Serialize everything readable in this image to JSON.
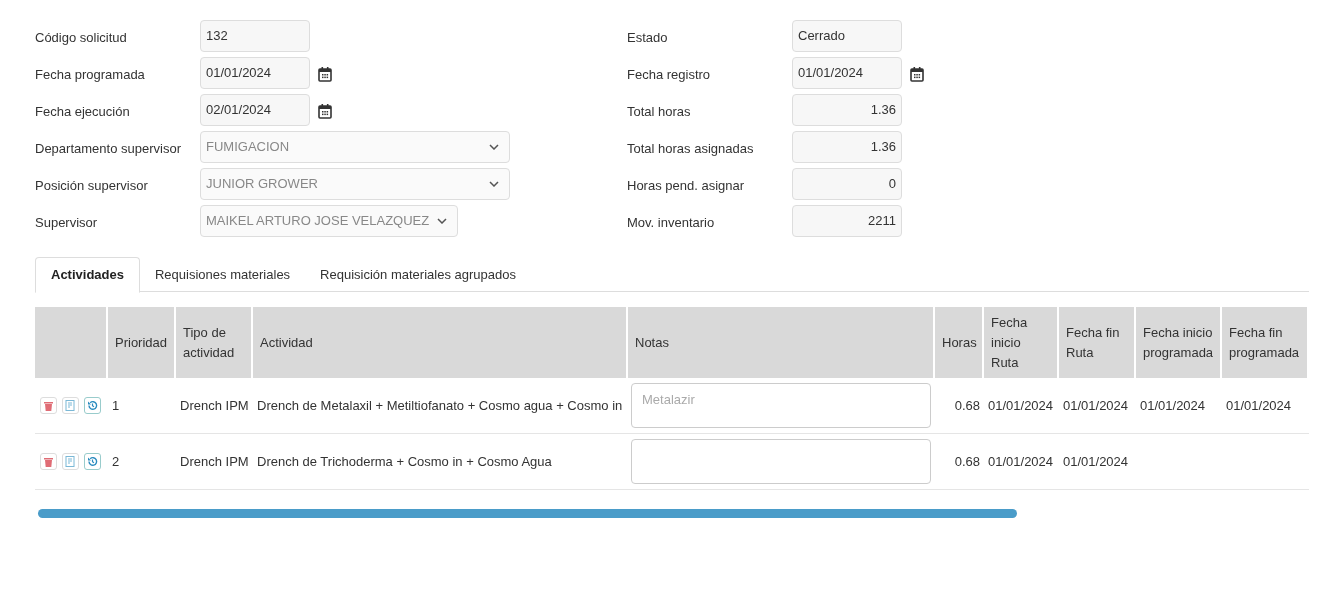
{
  "form": {
    "left_fields": [
      {
        "label": "Código solicitud",
        "kind": "text",
        "value": "132"
      },
      {
        "label": "Fecha programada",
        "kind": "date",
        "value": "01/01/2024"
      },
      {
        "label": "Fecha ejecución",
        "kind": "date",
        "value": "02/01/2024"
      },
      {
        "label": "Departamento supervisor",
        "kind": "select",
        "value": "FUMIGACION"
      },
      {
        "label": "Posición supervisor",
        "kind": "select",
        "value": "JUNIOR GROWER"
      },
      {
        "label": "Supervisor",
        "kind": "select",
        "value": "MAIKEL ARTURO JOSE VELAZQUEZ"
      }
    ],
    "right_fields": [
      {
        "label": "Estado",
        "kind": "text",
        "value": "Cerrado"
      },
      {
        "label": "Fecha registro",
        "kind": "date",
        "value": "01/01/2024"
      },
      {
        "label": "Total horas",
        "kind": "number",
        "value": "1.36"
      },
      {
        "label": "Total horas asignadas",
        "kind": "number",
        "value": "1.36"
      },
      {
        "label": "Horas pend. asignar",
        "kind": "number",
        "value": "0"
      },
      {
        "label": "Mov. inventario",
        "kind": "number",
        "value": "2211"
      }
    ]
  },
  "tabs": [
    {
      "label": "Actividades",
      "selected": true
    },
    {
      "label": "Requisiones materiales",
      "selected": false
    },
    {
      "label": "Requisición materiales agrupados",
      "selected": false
    }
  ],
  "table": {
    "columns": [
      "Prioridad",
      "Tipo de actividad",
      "Actividad",
      "Notas",
      "Horas",
      "Fecha inicio Ruta",
      "Fecha fin Ruta",
      "Fecha inicio programada",
      "Fecha fin programada"
    ],
    "rows": [
      {
        "prioridad": "1",
        "tipo": "Drench IPM",
        "actividad": "Drench de Metalaxil + Metiltiofanato + Cosmo agua + Cosmo in",
        "notas_placeholder": "Metalazir",
        "horas": "0.68",
        "fecha_inicio_ruta": "01/01/2024",
        "fecha_fin_ruta": "01/01/2024",
        "fecha_inicio_programada": "01/01/2024",
        "fecha_fin_programada": "01/01/2024"
      },
      {
        "prioridad": "2",
        "tipo": "Drench IPM",
        "actividad": "Drench de Trichoderma + Cosmo in + Cosmo Agua",
        "horas": "0.68",
        "fecha_inicio_ruta": "01/01/2024",
        "fecha_fin_ruta": "01/01/2024"
      }
    ]
  }
}
